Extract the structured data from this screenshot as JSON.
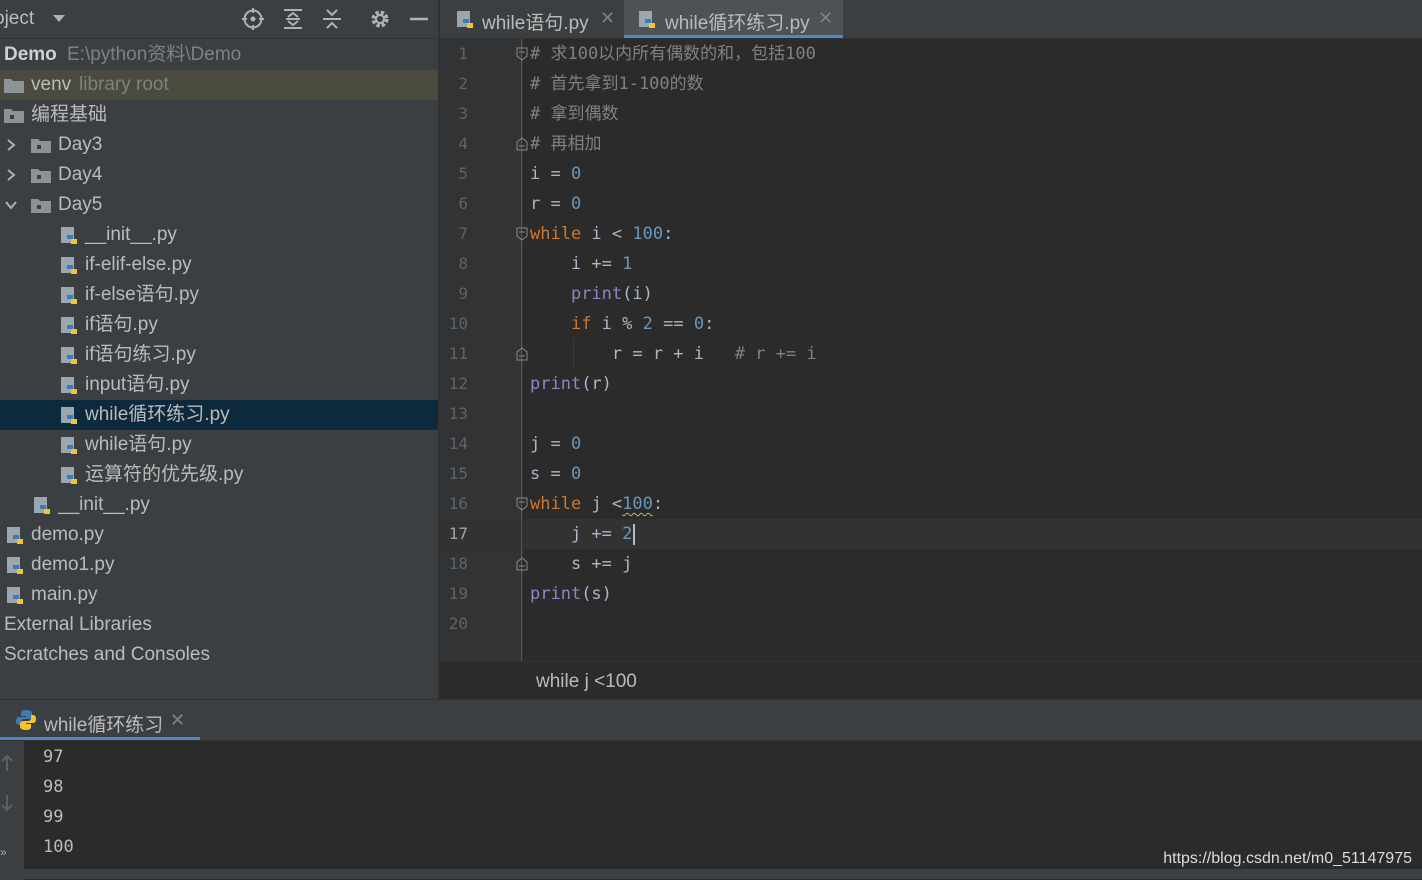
{
  "project_panel": {
    "title": "oject",
    "tree": [
      {
        "label": "Demo",
        "path": "E:\\python资料\\Demo",
        "kind": "root"
      },
      {
        "label": "venv",
        "path": "library root",
        "kind": "folder"
      },
      {
        "label": "编程基础",
        "kind": "folder"
      },
      {
        "label": "Day3",
        "kind": "folder",
        "state": "collapsed"
      },
      {
        "label": "Day4",
        "kind": "folder",
        "state": "collapsed"
      },
      {
        "label": "Day5",
        "kind": "folder",
        "state": "expanded"
      },
      {
        "label": "__init__.py",
        "kind": "file"
      },
      {
        "label": "if-elif-else.py",
        "kind": "file"
      },
      {
        "label": "if-else语句.py",
        "kind": "file"
      },
      {
        "label": "if语句.py",
        "kind": "file"
      },
      {
        "label": "if语句练习.py",
        "kind": "file"
      },
      {
        "label": "input语句.py",
        "kind": "file"
      },
      {
        "label": "while循环练习.py",
        "kind": "file",
        "selected": true
      },
      {
        "label": "while语句.py",
        "kind": "file"
      },
      {
        "label": "运算符的优先级.py",
        "kind": "file"
      },
      {
        "label": "__init__.py",
        "kind": "file"
      },
      {
        "label": "demo.py",
        "kind": "file"
      },
      {
        "label": "demo1.py",
        "kind": "file"
      },
      {
        "label": "main.py",
        "kind": "file"
      },
      {
        "label": "External Libraries",
        "kind": "node"
      },
      {
        "label": "Scratches and Consoles",
        "kind": "node"
      }
    ]
  },
  "editor": {
    "tabs": [
      {
        "label": "while语句.py",
        "active": false
      },
      {
        "label": "while循环练习.py",
        "active": true
      }
    ],
    "current_line": 17,
    "line_numbers": [
      "1",
      "2",
      "3",
      "4",
      "5",
      "6",
      "7",
      "8",
      "9",
      "10",
      "11",
      "12",
      "13",
      "14",
      "15",
      "16",
      "17",
      "18",
      "19",
      "20"
    ],
    "code_lines": [
      "# 求100以内所有偶数的和，包括100",
      "# 首先拿到1-100的数",
      "# 拿到偶数",
      "# 再相加",
      "i = 0",
      "r = 0",
      "while i < 100:",
      "    i += 1",
      "    print(i)",
      "    if i % 2 == 0:",
      "        r = r + i   # r += i",
      "print(r)",
      "",
      "j = 0",
      "s = 0",
      "while j <100:",
      "    j += 2",
      "    s += j",
      "print(s)",
      ""
    ],
    "breadcrumb": "while j <100"
  },
  "run_panel": {
    "tab_label": "while循环练习",
    "output": [
      "97",
      "98",
      "99",
      "100"
    ]
  },
  "watermark": "https://blog.csdn.net/m0_51147975",
  "colors": {
    "keyword": "#cc7832",
    "number": "#6897bb",
    "builtin": "#8888c6",
    "comment": "#808080",
    "selection": "#0d293e",
    "accent": "#4a88c7"
  },
  "icons": [
    "locate-icon",
    "expand-all-icon",
    "collapse-all-icon",
    "gear-icon",
    "minimize-icon",
    "folder-icon",
    "python-file-icon",
    "arrow-up-icon",
    "arrow-down-icon",
    "more-icon"
  ]
}
